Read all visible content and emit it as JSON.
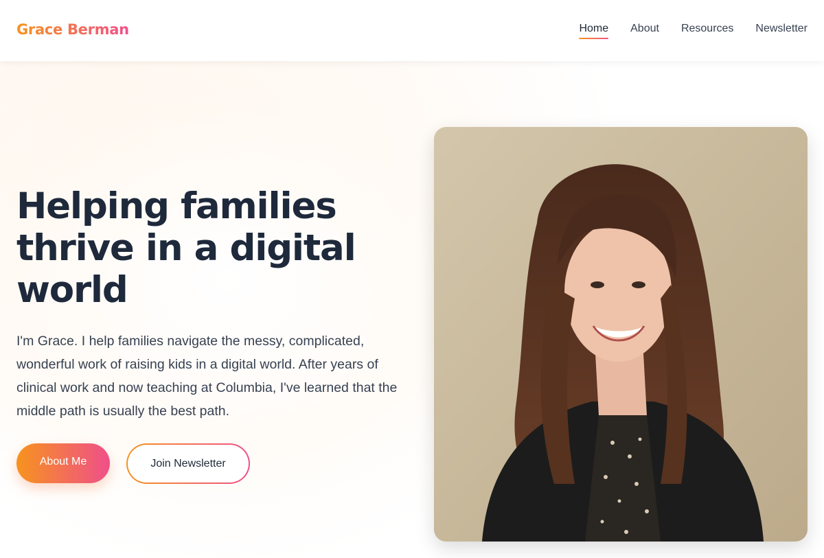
{
  "brand": {
    "name": "Grace Berman"
  },
  "nav": {
    "items": [
      {
        "label": "Home",
        "active": true
      },
      {
        "label": "About",
        "active": false
      },
      {
        "label": "Resources",
        "active": false
      },
      {
        "label": "Newsletter",
        "active": false
      }
    ]
  },
  "hero": {
    "heading": "Helping families thrive in a digital world",
    "intro": "I'm Grace. I help families navigate the messy, complicated, wonderful work of raising kids in a digital world. After years of clinical work and now teaching at Columbia, I've learned that the middle path is usually the best path.",
    "primary_button": "About Me",
    "secondary_button": "Join Newsletter"
  },
  "colors": {
    "gradient_start": "#f7931e",
    "gradient_end": "#ef4f8a",
    "heading": "#1e293b",
    "body_text": "#374151"
  }
}
